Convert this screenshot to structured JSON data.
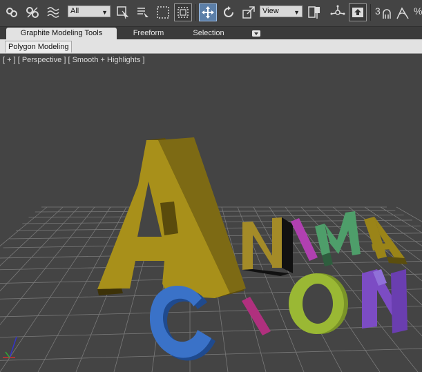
{
  "toolbar": {
    "selection_filter": "All",
    "reference_coord": "View",
    "snap_toggle_label": "3",
    "percent_snap_label": "%",
    "icons": [
      "link-icon",
      "unlink-icon",
      "bind-spacewarp-icon",
      "select-object-icon",
      "select-by-name-icon",
      "rectangular-selection-icon",
      "window-crossing-icon",
      "select-and-move-icon",
      "select-and-rotate-icon",
      "select-and-scale-icon",
      "use-pivot-center-icon",
      "select-and-manipulate-icon",
      "keyboard-shortcut-override-icon",
      "snaps-toggle-icon",
      "angle-snap-icon"
    ]
  },
  "ribbon": {
    "tabs": [
      {
        "label": "Graphite Modeling Tools",
        "active": true
      },
      {
        "label": "Freeform",
        "active": false
      },
      {
        "label": "Selection",
        "active": false
      }
    ],
    "panel_tab": "Polygon Modeling"
  },
  "viewport": {
    "label": "[ + ] [ Perspective ] [ Smooth + Highlights ]",
    "scene_text": "ANIMACION",
    "colors": {
      "background": "#444444",
      "grid": "#7a7a7a",
      "A": "#a8901a",
      "N1": "#a48b28",
      "I": "#b040b0",
      "M": "#4e9e6a",
      "A2": "#9a8418",
      "C": "#3a72c8",
      "I2": "#b0307e",
      "O": "#9ab834",
      "N2": "#7c4cc4"
    }
  }
}
